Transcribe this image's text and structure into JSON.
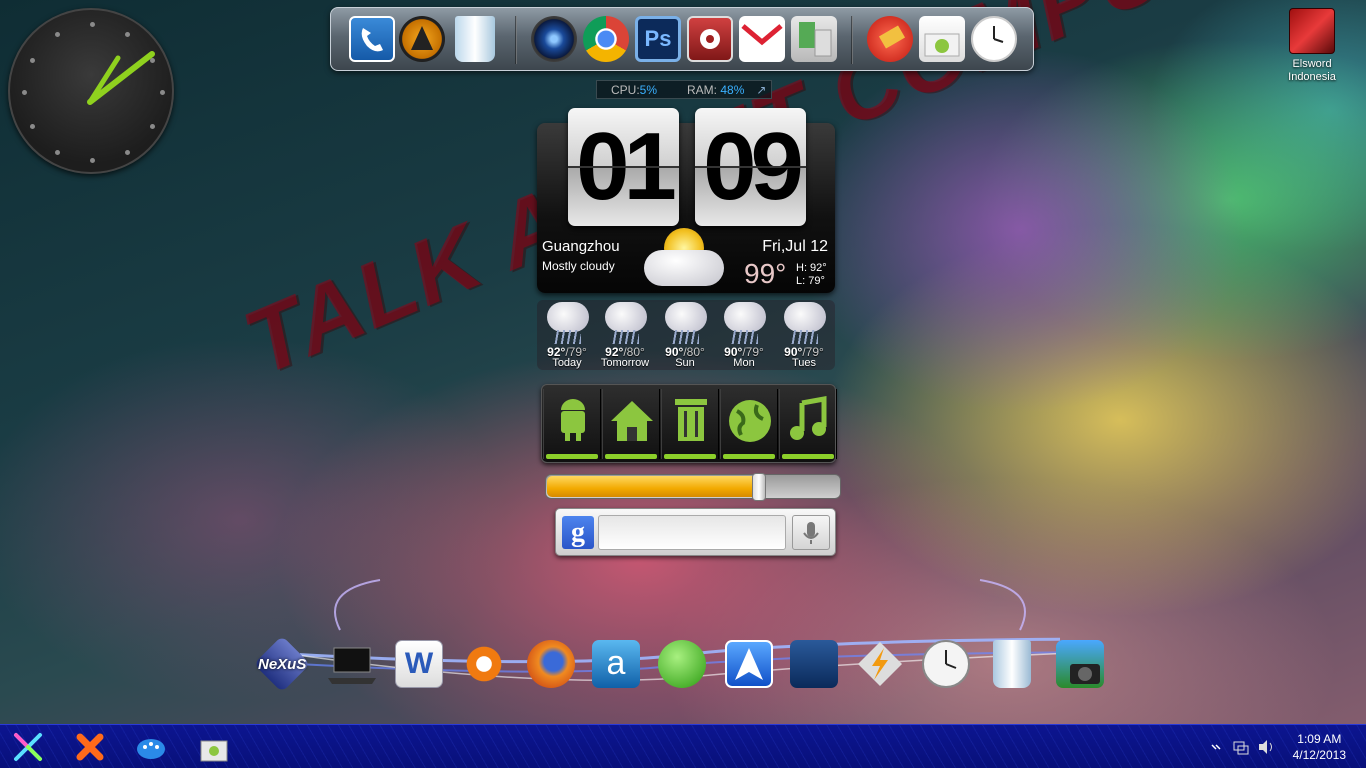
{
  "watermark": "TALK ABOUT COMPUTER",
  "system": {
    "cpu_label": "CPU:",
    "cpu_value": "5%",
    "ram_label": "RAM:",
    "ram_value": "48%"
  },
  "clock": {
    "hours": "01",
    "minutes": "09"
  },
  "weather": {
    "city": "Guangzhou",
    "condition": "Mostly cloudy",
    "date": "Fri,Jul 12",
    "temp": "99°",
    "high": "H: 92°",
    "low": "L: 79°",
    "forecast": [
      {
        "high": "92°",
        "low": "/79°",
        "day": "Today"
      },
      {
        "high": "92°",
        "low": "/80°",
        "day": "Tomorrow"
      },
      {
        "high": "90°",
        "low": "/80°",
        "day": "Sun"
      },
      {
        "high": "90°",
        "low": "/79°",
        "day": "Mon"
      },
      {
        "high": "90°",
        "low": "/79°",
        "day": "Tues"
      }
    ]
  },
  "top_dock": [
    "phone-icon",
    "aimp-icon",
    "recycle-bin-icon",
    "speaker-icon",
    "chrome-icon",
    "photoshop-icon",
    "settings-icon",
    "gmail-icon",
    "android-phone-icon",
    "ccleaner-icon",
    "android-market-icon",
    "clock-icon"
  ],
  "app_panel": [
    "android-icon",
    "home-icon",
    "trash-icon",
    "globe-icon",
    "music-icon"
  ],
  "brightness": 0.72,
  "bottom_dock": {
    "nexus_label": "NeXuS",
    "word_letter": "W",
    "items": [
      "nexus-icon",
      "laptop-icon",
      "word-icon",
      "avast-icon",
      "firefox-icon",
      "ati-icon",
      "add-icon",
      "arrow-browser-icon",
      "counter-strike-icon",
      "winamp-icon",
      "clock-icon",
      "recycle-bin-icon",
      "camera-icon"
    ]
  },
  "desktop_icon": {
    "line1": "Elsword",
    "line2": "Indonesia"
  },
  "taskbar": {
    "time": "1:09 AM",
    "date": "4/12/2013"
  },
  "colors": {
    "accent": "#3ab0ff",
    "bar_green": "#8ccf2a",
    "slider_orange": "#f2a900",
    "taskbar": "#0c1590"
  }
}
